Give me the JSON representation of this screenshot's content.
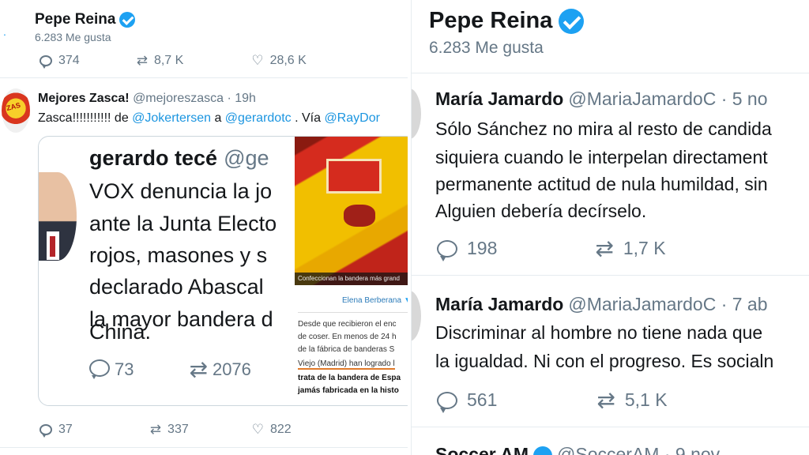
{
  "left": {
    "profile": {
      "name": "Pepe Reina",
      "likes": "6.283 Me gusta"
    },
    "top_actions": {
      "replies": "374",
      "retweets": "8,7 K",
      "likes": "28,6 K"
    },
    "tweet": {
      "name": "Mejores Zasca!",
      "handle_time": "@mejoreszasca · 19h",
      "text_prefix": "Zasca!!!!!!!!!!! de ",
      "mention1": "@Jokertersen",
      "text_mid": " a ",
      "mention2": "@gerardotc",
      "text_via": " . Vía ",
      "mention3": "@RayDor",
      "avatar_text": "ZAS",
      "card": {
        "name": "gerardo tecé",
        "handle": "@ge",
        "lines": [
          "VOX denuncia la jo",
          "ante la Junta Electo",
          "rojos, masones y s",
          "declarado Abascal",
          "la mayor bandera d",
          "China."
        ],
        "replies": "73",
        "retweets": "2076",
        "news": {
          "caption": "Confeccionan la bandera más grand",
          "author": "Elena Berberana",
          "lines": [
            "Desde que recibieron el enc",
            "de coser. En menos de 24 h",
            "de la fábrica de banderas S",
            "Viejo (Madrid) han logrado l",
            "trata de la bandera de Espa",
            "jamás fabricada en la histo"
          ]
        }
      },
      "actions": {
        "replies": "37",
        "retweets": "337",
        "likes": "822"
      }
    }
  },
  "right": {
    "profile": {
      "name": "Pepe Reina",
      "likes": "6.283 Me gusta"
    },
    "tweets": [
      {
        "name": "María Jamardo",
        "handle_time": "@MariaJamardoC · 5 no",
        "lines": [
          "Sólo Sánchez no mira al resto de candida",
          "siquiera cuando le interpelan directament",
          "permanente actitud de nula humildad, sin",
          "Alguien debería decírselo."
        ],
        "replies": "198",
        "retweets": "1,7 K"
      },
      {
        "name": "María Jamardo",
        "handle_time": "@MariaJamardoC · 7 ab",
        "lines": [
          "Discriminar al hombre no tiene nada que",
          "la igualdad. Ni con el progreso. Es socialn"
        ],
        "replies": "561",
        "retweets": "5,1 K"
      }
    ],
    "cut_tweet": {
      "name": "Soccer AM",
      "handle_time": "@SoccerAM · 9 nov"
    }
  },
  "colors": {
    "accent": "#1da1f2",
    "mention": "#1b95e0",
    "muted": "#657786",
    "text": "#14171a"
  },
  "icons": [
    "verified-badge-icon",
    "reply-icon",
    "retweet-icon",
    "like-icon"
  ]
}
